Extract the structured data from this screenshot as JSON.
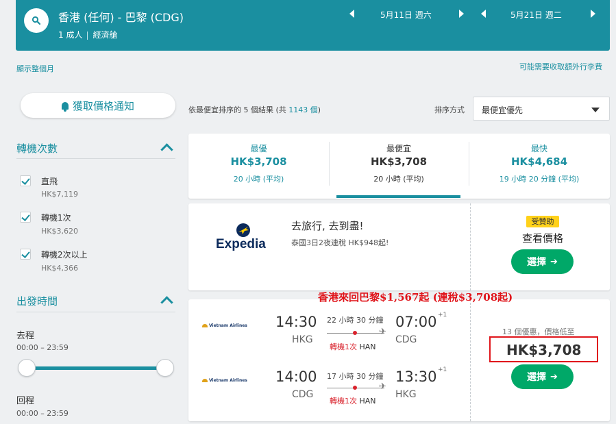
{
  "header": {
    "route": "香港 (任何) - 巴黎 (CDG)",
    "passengers": "1 成人",
    "cabin": "經濟艙",
    "depart_date": "5月11日 週六",
    "return_date": "5月21日 週二"
  },
  "links": {
    "show_month": "顯示整個月",
    "extra_baggage": "可能需要收取額外行李費"
  },
  "alert_button": "獲取價格通知",
  "filters": {
    "stops_title": "轉機次數",
    "stops": [
      {
        "label": "直飛",
        "price": "HK$7,119"
      },
      {
        "label": "轉機1次",
        "price": "HK$3,620"
      },
      {
        "label": "轉機2次以上",
        "price": "HK$4,366"
      }
    ],
    "times_title": "出發時間",
    "outbound_label": "去程",
    "outbound_range": "00:00 – 23:59",
    "return_label": "回程",
    "return_range": "00:00 – 23:59"
  },
  "results": {
    "prefix": "依",
    "sort_word": "最便宜",
    "middle": "排序的 5 個結果 (共 ",
    "total": "1143 個",
    "suffix": ")",
    "sort_label": "排序方式",
    "sort_value": "最便宜優先"
  },
  "tabs": [
    {
      "title": "最優",
      "price": "HK$3,708",
      "duration": "20 小時 (平均)"
    },
    {
      "title": "最便宜",
      "price": "HK$3,708",
      "duration": "20 小時 (平均)"
    },
    {
      "title": "最快",
      "price": "HK$4,684",
      "duration": "19 小時 20 分鐘 (平均)"
    }
  ],
  "ad": {
    "brand": "Expedia",
    "title": "去旅行, 去到盡!",
    "subtitle": "泰國3日2夜連稅 HK$948起!",
    "badge": "受贊助",
    "cta_text": "查看價格",
    "button": "選擇"
  },
  "flight": {
    "airline": "Vietnam Airlines",
    "legs": [
      {
        "dep_time": "14:30",
        "dep_airport": "HKG",
        "duration": "22 小時 30 分鐘",
        "arr_time": "07:00",
        "day_offset": "+1",
        "arr_airport": "CDG",
        "stops": "轉機1次",
        "via": "HAN"
      },
      {
        "dep_time": "14:00",
        "dep_airport": "CDG",
        "duration": "17 小時 30 分鐘",
        "arr_time": "13:30",
        "day_offset": "+1",
        "arr_airport": "HKG",
        "stops": "轉機1次",
        "via": "HAN"
      }
    ],
    "deals": "13 個優惠，價格低至",
    "price": "HK$3,708",
    "button": "選擇"
  },
  "annotation": "香港來回巴黎$1,567起 (連稅$3,708起)",
  "colors": {
    "accent": "#1a8fa0",
    "select_green": "#00a868",
    "highlight_red": "#e0151b",
    "badge_yellow": "#ffd11a"
  }
}
